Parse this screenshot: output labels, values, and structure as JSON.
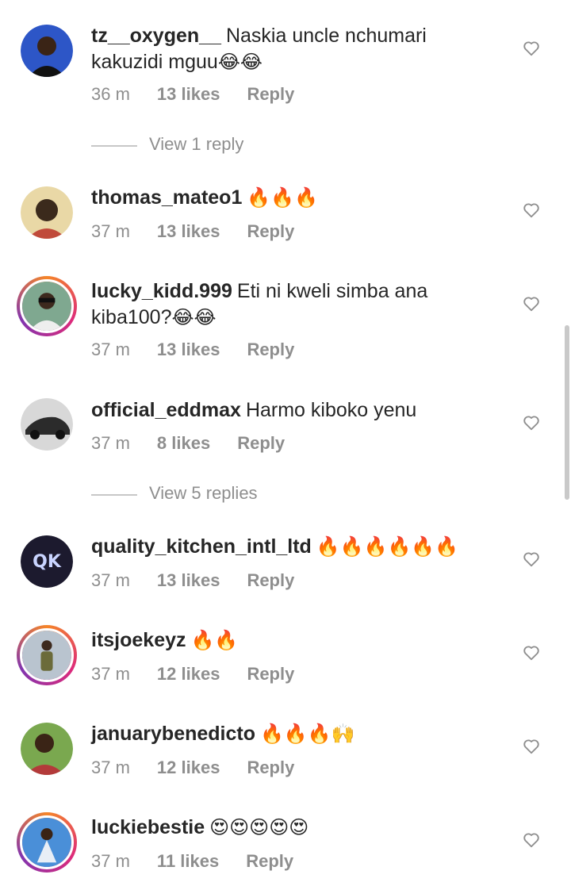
{
  "comments": [
    {
      "username": "tz__oxygen__",
      "text": "Naskia uncle nchumari kakuzidi mguu",
      "emoji": "😂😂",
      "time": "36 m",
      "likes": "13 likes",
      "reply": "Reply",
      "avatar_color": "#2d56c7"
    },
    {
      "username": "thomas_mateo1",
      "text": "",
      "emoji": "🔥🔥🔥",
      "time": "37 m",
      "likes": "13 likes",
      "reply": "Reply",
      "avatar_color": "#e9d8a6"
    },
    {
      "username": "lucky_kidd.999",
      "text": "Eti ni kweli simba ana kiba100?",
      "emoji": "😂😂",
      "time": "37 m",
      "likes": "13 likes",
      "reply": "Reply",
      "avatar_color": "#7fa890"
    },
    {
      "username": "official_eddmax",
      "text": "Harmo kiboko yenu",
      "emoji": "",
      "time": "37 m",
      "likes": "8 likes",
      "reply": "Reply",
      "avatar_color": "#5a5a5a"
    },
    {
      "username": "quality_kitchen_intl_ltd",
      "text": "",
      "emoji": "🔥🔥🔥🔥🔥🔥",
      "time": "37 m",
      "likes": "13 likes",
      "reply": "Reply",
      "avatar_color": "#1c1a2e"
    },
    {
      "username": "itsjoekeyz",
      "text": "",
      "emoji": "🔥🔥",
      "time": "37 m",
      "likes": "12 likes",
      "reply": "Reply",
      "avatar_color": "#b9c4cf"
    },
    {
      "username": "januarybenedicto",
      "text": "",
      "emoji": "🔥🔥🔥🙌",
      "time": "37 m",
      "likes": "12 likes",
      "reply": "Reply",
      "avatar_color": "#7aa84f"
    },
    {
      "username": "luckiebestie",
      "text": "",
      "emoji": "😍😍😍😍😍",
      "time": "37 m",
      "likes": "11 likes",
      "reply": "Reply",
      "avatar_color": "#4a8fd8"
    }
  ],
  "view_replies": [
    "View 1 reply",
    "View 5 replies"
  ],
  "icons": {
    "like": "heart-outline-icon"
  }
}
